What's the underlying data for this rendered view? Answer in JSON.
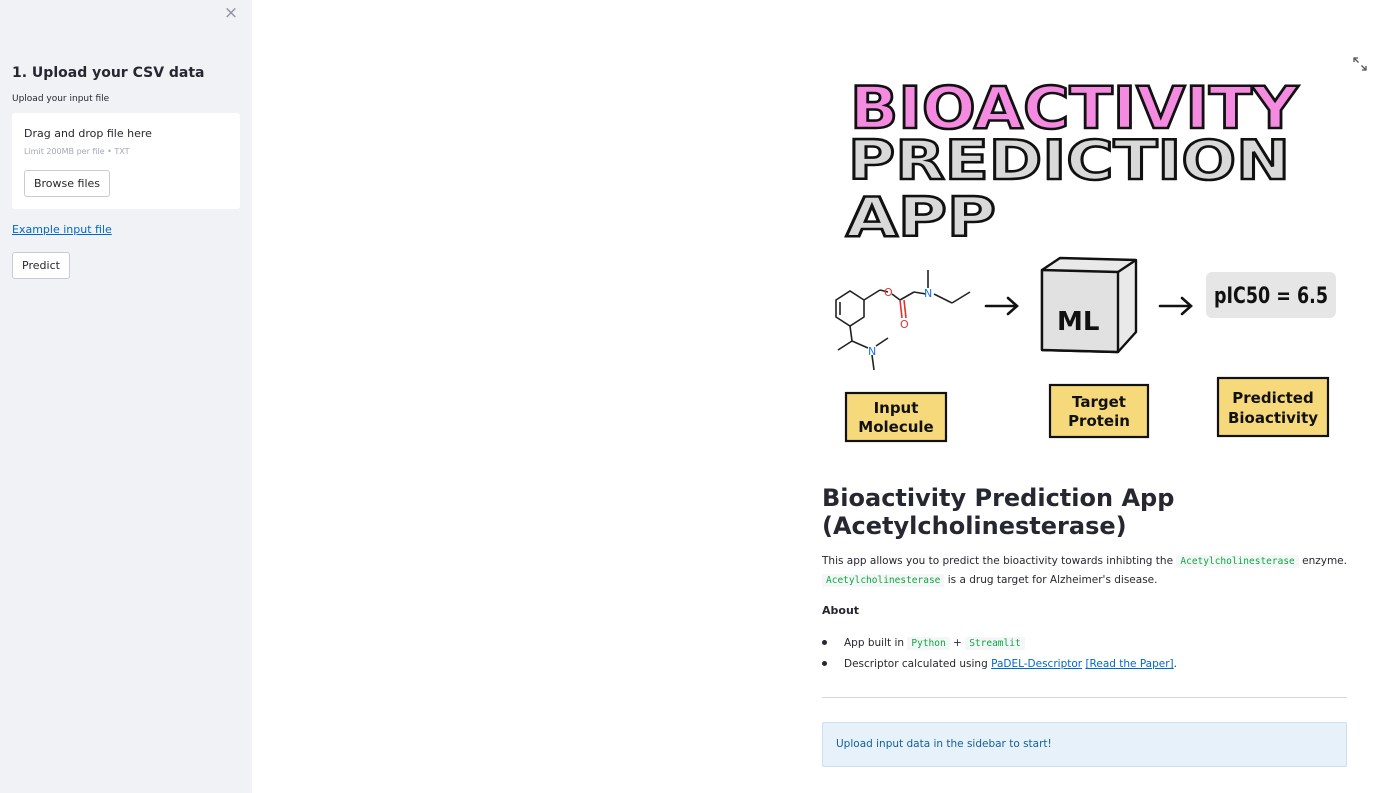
{
  "sidebar": {
    "close_symbol": "×",
    "title": "1. Upload your CSV data",
    "upload_label": "Upload your input file",
    "dropzone_text": "Drag and drop file here",
    "dropzone_limit": "Limit 200MB per file • TXT",
    "browse_label": "Browse files",
    "example_link": "Example input file",
    "predict_label": "Predict"
  },
  "banner": {
    "line1": "BIOACTIVITY",
    "line2": "PREDICTION",
    "line3": "APP",
    "box_label": "ML",
    "output_label": "pIC50 = 6.5",
    "caption_input_1": "Input",
    "caption_input_2": "Molecule",
    "caption_target_1": "Target",
    "caption_target_2": "Protein",
    "caption_pred_1": "Predicted",
    "caption_pred_2": "Bioactivity",
    "atom_o": "O",
    "atom_n": "N"
  },
  "main": {
    "title": "Bioactivity Prediction App (Acetylcholinesterase)",
    "desc_1": "This app allows you to predict the bioactivity towards inhibting the ",
    "desc_code_1": "Acetylcholinesterase",
    "desc_2": " enzyme. ",
    "desc_code_2": "Acetylcholinesterase",
    "desc_3": " is a drug target for Alzheimer's disease.",
    "about_heading": "About",
    "about_1_prefix": "App built in ",
    "about_1_code1": "Python",
    "about_1_plus": " + ",
    "about_1_code2": "Streamlit",
    "about_2_prefix": "Descriptor calculated using ",
    "about_2_link1": "PaDEL-Descriptor",
    "about_2_space": " ",
    "about_2_link2": "[Read the Paper]",
    "about_2_suffix": ".",
    "info": "Upload input data in the sidebar to start!"
  },
  "icons": {
    "close": "close-icon",
    "expand": "expand-icon"
  },
  "colors": {
    "sidebar_bg": "#f0f2f6",
    "link": "#0068c9",
    "code_text": "#09ab3b",
    "info_bg": "#e7f1fa",
    "banner_pink": "#f58be0",
    "banner_gray": "#d9d9d9",
    "banner_yellow": "#f6d97a"
  }
}
